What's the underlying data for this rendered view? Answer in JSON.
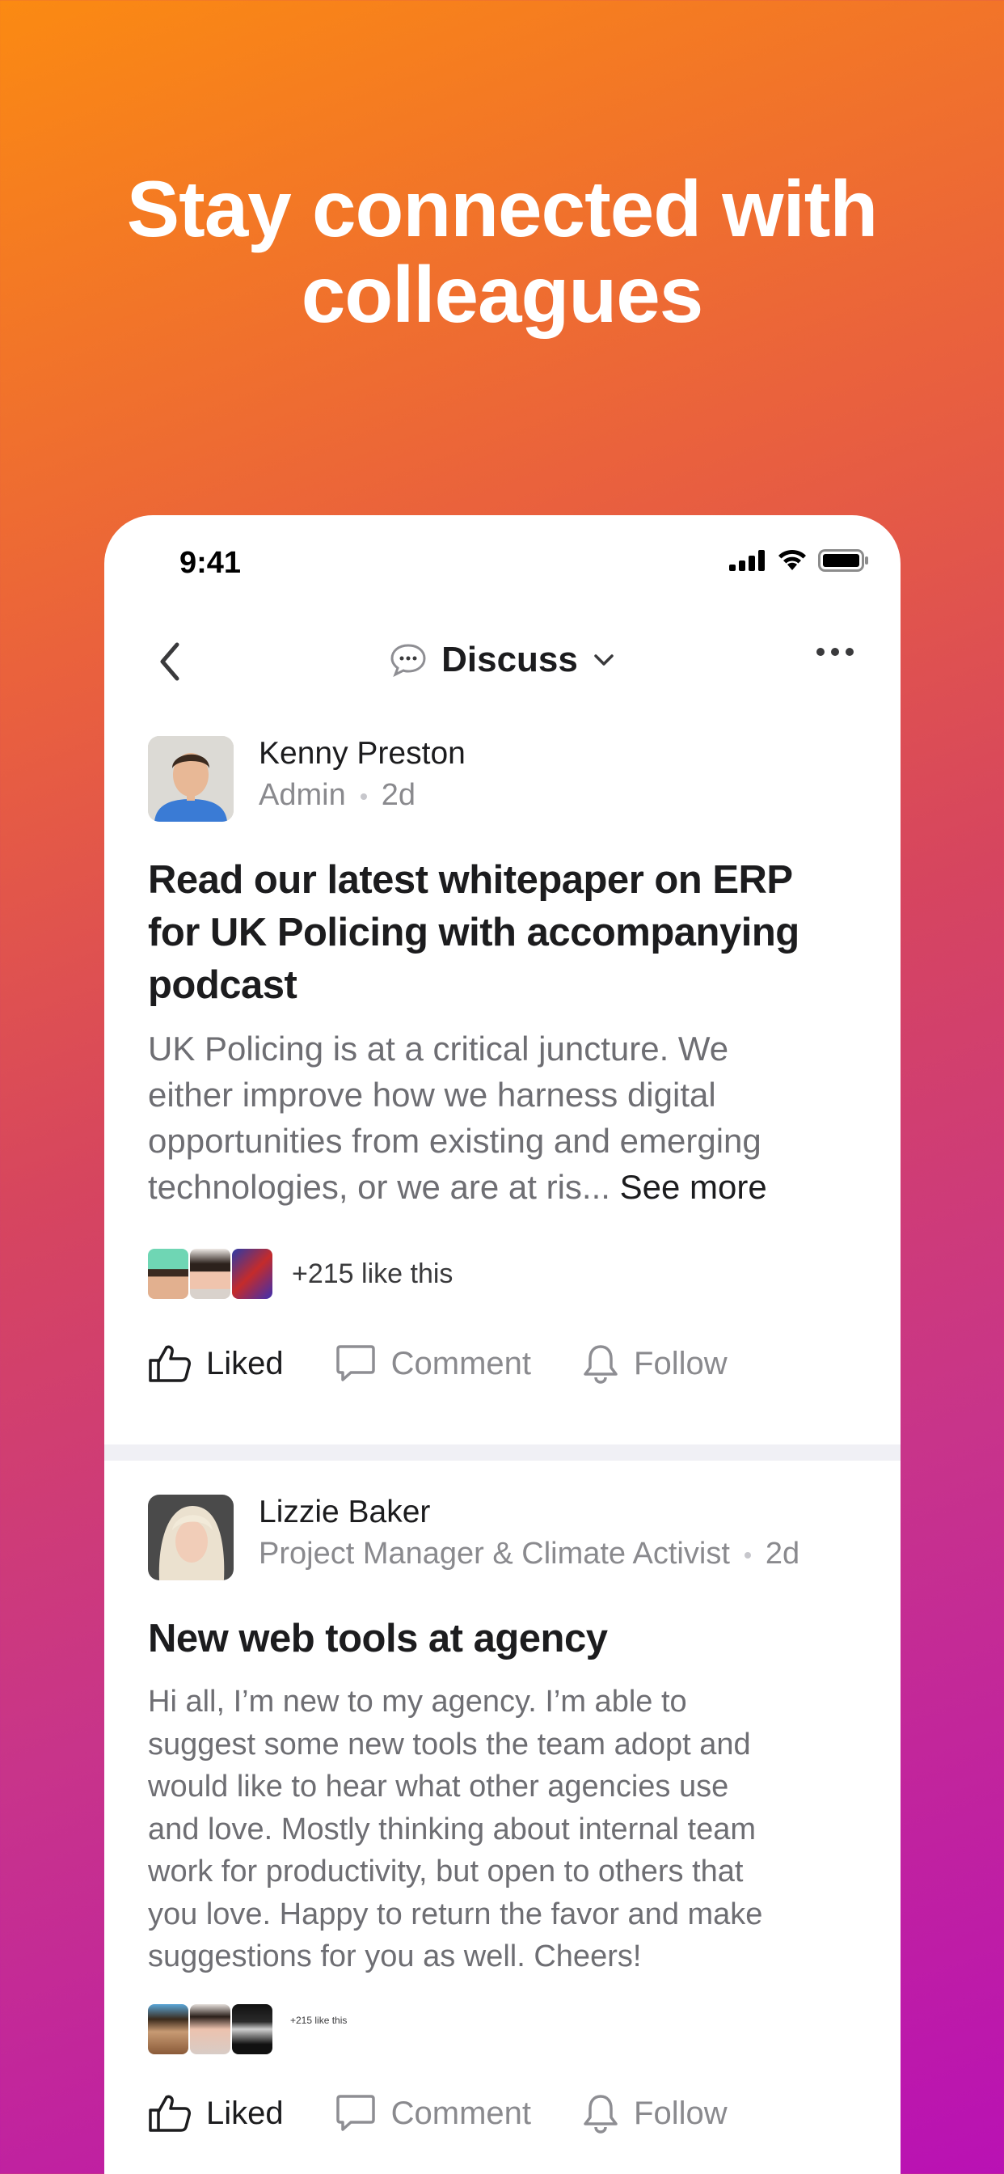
{
  "hero": {
    "line1": "Stay connected with",
    "line2": "colleagues"
  },
  "status_bar": {
    "time": "9:41",
    "icons": [
      "signal-icon",
      "wifi-icon",
      "battery-icon"
    ]
  },
  "nav": {
    "back_icon": "chevron-left-icon",
    "channel_icon": "speech-bubble-icon",
    "title": "Discuss",
    "dropdown_icon": "chevron-down-icon",
    "more_icon": "more-dots-icon"
  },
  "posts": [
    {
      "author": "Kenny Preston",
      "role": "Admin",
      "age": "2d",
      "title": [
        "Read our latest whitepaper on ERP",
        "for UK Policing with accompanying",
        "podcast"
      ],
      "body": [
        "UK Policing is at a critical juncture. We",
        "either improve how we harness digital",
        "opportunities from existing and emerging",
        "technologies, or we are at ris... "
      ],
      "see_more": "See more",
      "likes_text": "+215 like this",
      "actions": {
        "like": "Liked",
        "comment": "Comment",
        "follow": "Follow"
      }
    },
    {
      "author": "Lizzie Baker",
      "role": "Project Manager & Climate Activist",
      "age": "2d",
      "title": [
        "New web tools at agency"
      ],
      "body": [
        "Hi all, I’m new to my agency. I’m able to",
        "suggest some new tools the team adopt and",
        "would like to hear what other agencies use",
        "and love. Mostly thinking about internal team",
        "work for productivity, but open to others that",
        "you love. Happy to return the favor and make",
        "suggestions for you as well. Cheers!"
      ],
      "likes_text": "+215 like this",
      "actions": {
        "like": "Liked",
        "comment": "Comment",
        "follow": "Follow"
      }
    }
  ],
  "colors": {
    "accent_orange": "#fb8a12",
    "accent_magenta": "#b911b4",
    "text_primary": "#1c1c1e",
    "text_secondary": "#6e6e73"
  }
}
